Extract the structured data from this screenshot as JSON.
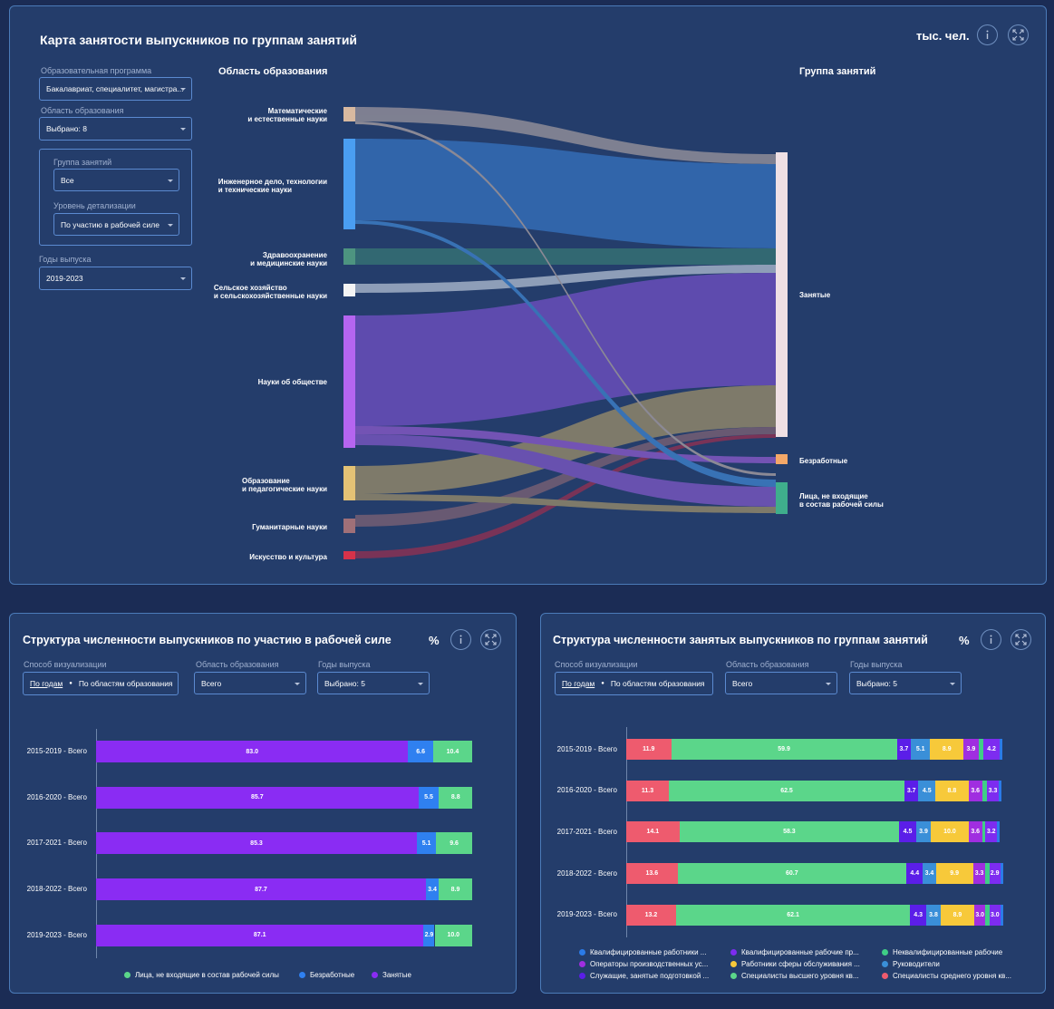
{
  "sankey_panel": {
    "title": "Карта занятости выпускников по группам занятий",
    "unit": "тыс. чел.",
    "filters": [
      {
        "label": "Образовательная программа",
        "value": "Бакалавриат, специалитет, магистра..."
      },
      {
        "label": "Область образования",
        "value": "Выбрано: 8"
      },
      {
        "label": "Группа занятий",
        "value": "Все"
      },
      {
        "label": "Уровень детализации",
        "value": "По участию в рабочей силе"
      },
      {
        "label": "Годы выпуска",
        "value": "2019-2023"
      }
    ],
    "left_header": "Область образования",
    "right_header": "Группа занятий",
    "sources": [
      {
        "line1": "Математические",
        "line2": "и естественные науки",
        "color": "#d8b9a0"
      },
      {
        "line1": "Инженерное дело, технологии",
        "line2": "и технические науки",
        "color": "#4a9ef2"
      },
      {
        "line1": "Здравоохранение",
        "line2": "и медицинские науки",
        "color": "#4d9480"
      },
      {
        "line1": "Сельское хозяйство",
        "line2": "и сельскохозяйственные науки",
        "color": "#f4f4f4"
      },
      {
        "line1": "Науки об обществе",
        "line2": "",
        "color": "#b565f0"
      },
      {
        "line1": "Образование",
        "line2": "и педагогические науки",
        "color": "#e4c275"
      },
      {
        "line1": "Гуманитарные науки",
        "line2": "",
        "color": "#a07078"
      },
      {
        "line1": "Искусство и культура",
        "line2": "",
        "color": "#d6324a"
      }
    ],
    "targets": [
      {
        "line1": "Занятые",
        "line2": "",
        "color": "#efe0e4"
      },
      {
        "line1": "Безработные",
        "line2": "",
        "color": "#f4a868"
      },
      {
        "line1": "Лица, не входящие",
        "line2": "в состав рабочей силы",
        "color": "#3fae8c"
      }
    ]
  },
  "participation_panel": {
    "title": "Структура численности выпускников по участию в рабочей силе",
    "unit": "%",
    "filters": {
      "viz_label": "Способ визуализации",
      "viz_active": "По годам",
      "viz_other": "По областям образования",
      "area_label": "Область образования",
      "area_value": "Всего",
      "years_label": "Годы выпуска",
      "years_value": "Выбрано: 5"
    },
    "chart_data": {
      "type": "bar",
      "orientation": "horizontal",
      "stacked": true,
      "categories": [
        "2015-2019 - Всего",
        "2016-2020 - Всего",
        "2017-2021 - Всего",
        "2018-2022 - Всего",
        "2019-2023 - Всего"
      ],
      "series": [
        {
          "name": "Занятые",
          "color": "#8a2cf3",
          "values": [
            83.0,
            85.7,
            85.3,
            87.7,
            87.1
          ]
        },
        {
          "name": "Безработные",
          "color": "#2f80f0",
          "values": [
            6.6,
            5.5,
            5.1,
            3.4,
            2.9
          ]
        },
        {
          "name": "Лица, не входящие в состав рабочей силы",
          "color": "#5bd68a",
          "values": [
            10.4,
            8.8,
            9.6,
            8.9,
            10.0
          ]
        }
      ],
      "legend_order": [
        "Лица, не входящие в состав рабочей силы",
        "Безработные",
        "Занятые"
      ],
      "legend_position": "bottom"
    }
  },
  "occupation_panel": {
    "title": "Структура численности занятых выпускников по группам занятий",
    "unit": "%",
    "filters": {
      "viz_label": "Способ визуализации",
      "viz_active": "По годам",
      "viz_other": "По областям образования",
      "area_label": "Область образования",
      "area_value": "Всего",
      "years_label": "Годы выпуска",
      "years_value": "Выбрано: 5"
    },
    "chart_data": {
      "type": "bar",
      "orientation": "horizontal",
      "stacked": true,
      "categories": [
        "2015-2019 - Всего",
        "2016-2020 - Всего",
        "2017-2021 - Всего",
        "2018-2022 - Всего",
        "2019-2023 - Всего"
      ],
      "series": [
        {
          "name": "Специалисты среднего уровня кв...",
          "color": "#ee5b6e",
          "values": [
            11.9,
            11.3,
            14.1,
            13.6,
            13.2
          ]
        },
        {
          "name": "Специалисты высшего уровня кв...",
          "color": "#5bd68a",
          "values": [
            59.9,
            62.5,
            58.3,
            60.7,
            62.1
          ]
        },
        {
          "name": "Служащие, занятые подготовкой ...",
          "color": "#5b1ee8",
          "values": [
            3.7,
            3.7,
            4.5,
            4.4,
            4.3
          ]
        },
        {
          "name": "Руководители",
          "color": "#3a8fd8",
          "values": [
            5.1,
            4.5,
            3.9,
            3.4,
            3.8
          ]
        },
        {
          "name": "Работники сферы обслуживания ...",
          "color": "#f7c93a",
          "values": [
            8.9,
            8.8,
            10.0,
            9.9,
            8.9
          ]
        },
        {
          "name": "Операторы производственных ус...",
          "color": "#a02ee0",
          "values": [
            3.9,
            3.6,
            3.6,
            3.3,
            3.0
          ]
        },
        {
          "name": "Неквалифицированные рабочие",
          "color": "#3fce86",
          "values": [
            1.4,
            1.2,
            0.8,
            1.0,
            1.0
          ]
        },
        {
          "name": "Квалифицированные рабочие пр...",
          "color": "#7d2cf0",
          "values": [
            4.2,
            3.3,
            3.2,
            2.9,
            3.0
          ]
        },
        {
          "name": "Квалифицированные работники ...",
          "color": "#2b7be8",
          "values": [
            0.8,
            0.6,
            0.6,
            0.7,
            0.6
          ]
        }
      ],
      "legend_order": [
        "Квалифицированные работники ...",
        "Квалифицированные рабочие пр...",
        "Неквалифицированные рабочие",
        "Операторы производственных ус...",
        "Работники сферы обслуживания ...",
        "Руководители",
        "Служащие, занятые подготовкой ...",
        "Специалисты высшего уровня кв...",
        "Специалисты среднего уровня кв..."
      ],
      "legend_position": "bottom"
    }
  }
}
